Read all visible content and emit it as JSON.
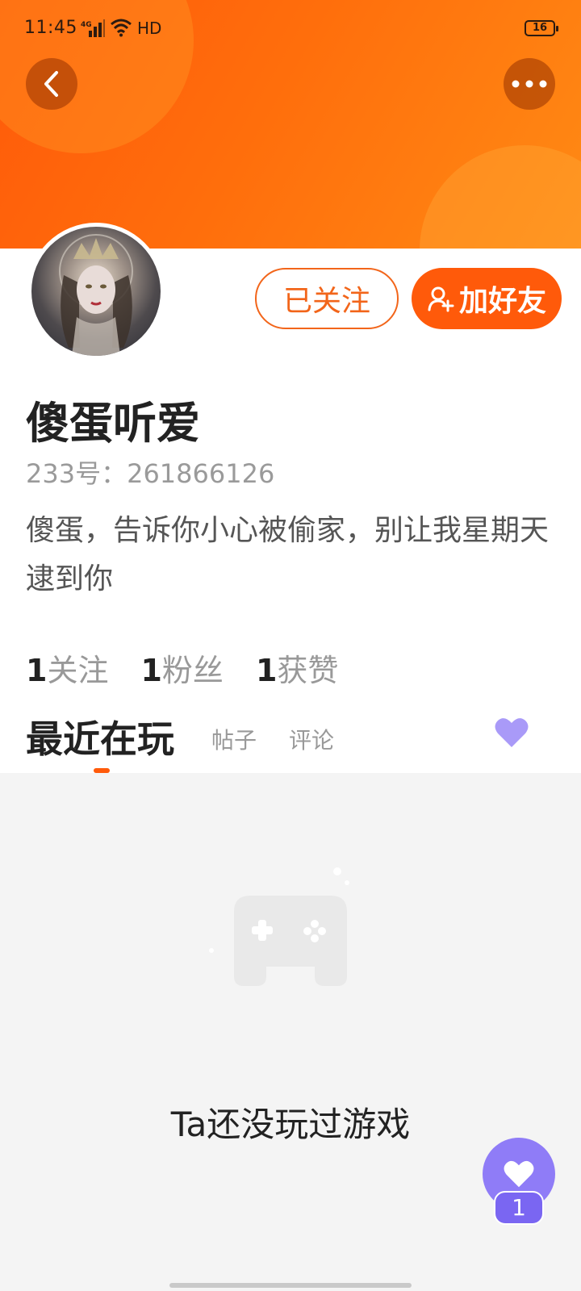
{
  "status_bar": {
    "time": "11:45",
    "network": "4G",
    "hd": "HD",
    "battery": "16"
  },
  "colors": {
    "accent": "#ff5a0a",
    "like_purple": "#8f7cf7"
  },
  "header": {
    "back_icon": "chevron-left-icon",
    "more_icon": "more-dots-icon"
  },
  "profile": {
    "follow_label": "已关注",
    "add_friend_label": "加好友",
    "username": "傻蛋听爱",
    "uid_label": "233号：261866126",
    "bio": "傻蛋，告诉你小心被偷家，别让我星期天逮到你"
  },
  "stats": [
    {
      "count": "1",
      "label": "关注"
    },
    {
      "count": "1",
      "label": "粉丝"
    },
    {
      "count": "1",
      "label": "获赞"
    }
  ],
  "tabs": {
    "active": "最近在玩",
    "posts": "帖子",
    "comments": "评论"
  },
  "empty_state": {
    "icon": "gamepad-icon",
    "text": "Ta还没玩过游戏"
  },
  "floating_like": {
    "count": "1"
  }
}
